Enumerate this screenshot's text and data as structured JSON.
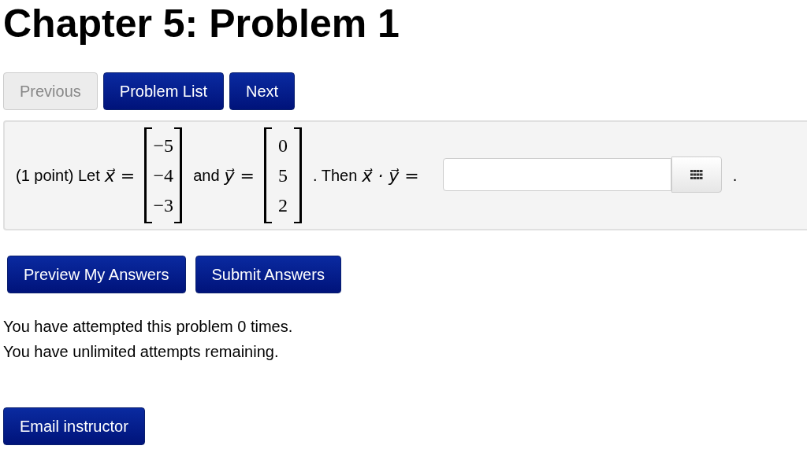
{
  "title": "Chapter 5: Problem 1",
  "nav_buttons": [
    {
      "label": "Previous",
      "disabled": true
    },
    {
      "label": "Problem List",
      "disabled": false
    },
    {
      "label": "Next",
      "disabled": false
    }
  ],
  "problem": {
    "points": "(1 point) Let",
    "parts": [
      {
        "kind": "math",
        "text": "x⃗ ="
      },
      {
        "kind": "vector",
        "values": [
          "−5",
          "−4",
          "−3"
        ]
      },
      {
        "kind": "text",
        "text": "and"
      },
      {
        "kind": "math",
        "text": "y⃗ ="
      },
      {
        "kind": "vector",
        "values": [
          "0",
          "5",
          "2"
        ]
      },
      {
        "kind": "text",
        "text": ". Then"
      },
      {
        "kind": "math",
        "text": "x⃗ · y⃗ ="
      },
      {
        "kind": "answer"
      },
      {
        "kind": "text",
        "text": "."
      }
    ]
  },
  "answer_buttons": [
    "Preview My Answers",
    "Submit Answers"
  ],
  "messages": [
    "You have attempted this problem 0 times.",
    "You have unlimited attempts remaining."
  ],
  "email_button": "Email instructor"
}
